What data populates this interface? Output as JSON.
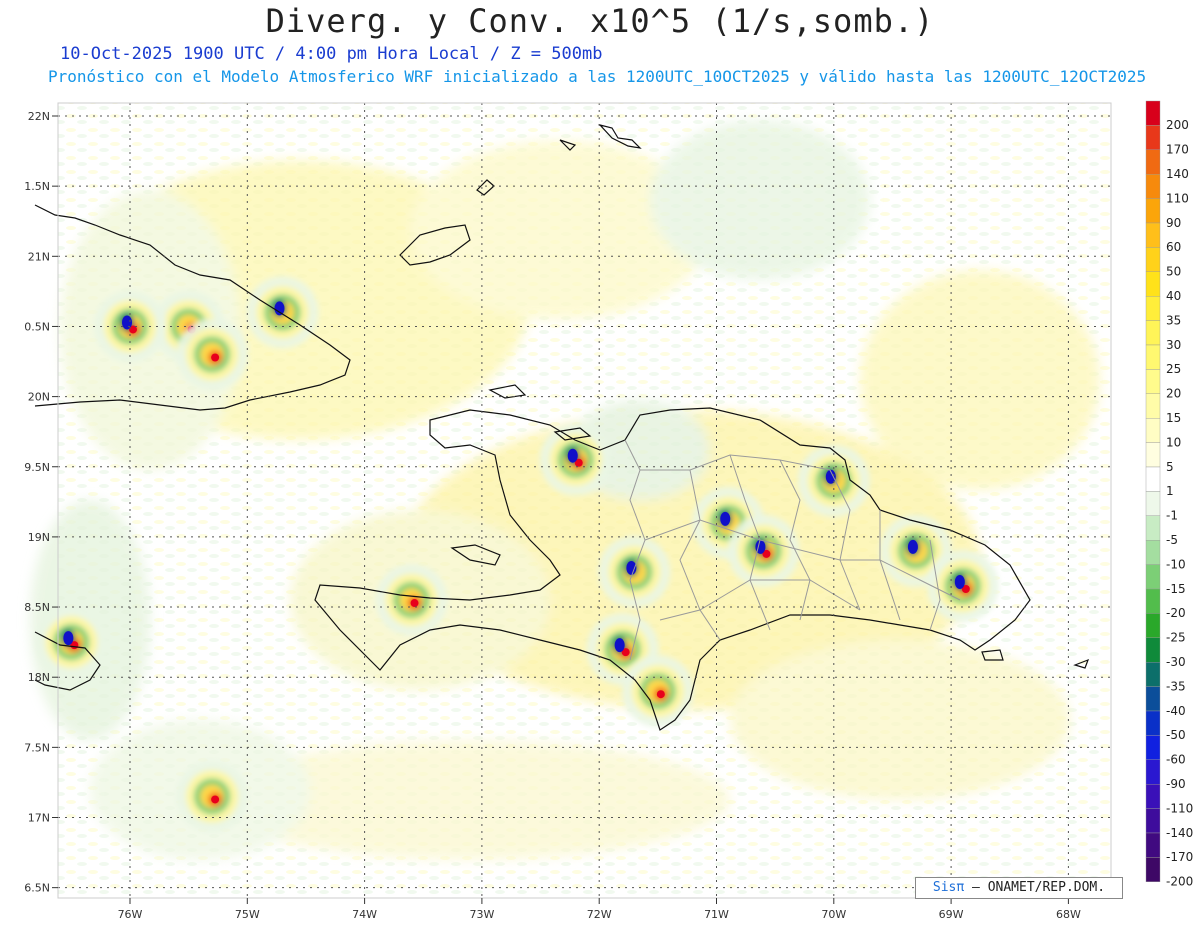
{
  "header": {
    "title": "Diverg. y Conv. x10^5 (1/s,somb.)",
    "subtitle_date": "10-Oct-2025  1900 UTC / 4:00 pm Hora Local / Z = 500mb",
    "subtitle_model": "Pronóstico con el Modelo Atmosferico WRF inicializado a las 1200UTC_10OCT2025 y válido hasta las  1200UTC_12OCT2025"
  },
  "map": {
    "lat_labels": [
      "22N",
      "1.5N",
      "21N",
      "0.5N",
      "20N",
      "9.5N",
      "19N",
      "8.5N",
      "18N",
      "7.5N",
      "17N",
      "6.5N"
    ],
    "lon_labels": [
      "76W",
      "75W",
      "74W",
      "73W",
      "72W",
      "71W",
      "70W",
      "69W",
      "68W"
    ],
    "features": [
      {
        "name": "convective-cell",
        "lon": -75.5,
        "lat": 20.5,
        "kind": "div"
      },
      {
        "name": "convective-cell",
        "lon": -74.7,
        "lat": 20.6,
        "kind": "conv"
      },
      {
        "name": "convective-cell",
        "lon": -76.0,
        "lat": 20.5,
        "kind": "mix"
      },
      {
        "name": "convective-cell",
        "lon": -75.3,
        "lat": 20.3,
        "kind": "div"
      },
      {
        "name": "convective-cell",
        "lon": -72.2,
        "lat": 19.55,
        "kind": "mix"
      },
      {
        "name": "convective-cell",
        "lon": -71.7,
        "lat": 18.75,
        "kind": "conv"
      },
      {
        "name": "convective-cell",
        "lon": -71.8,
        "lat": 18.2,
        "kind": "mix"
      },
      {
        "name": "convective-cell",
        "lon": -71.5,
        "lat": 17.9,
        "kind": "div"
      },
      {
        "name": "convective-cell",
        "lon": -70.9,
        "lat": 19.1,
        "kind": "conv"
      },
      {
        "name": "convective-cell",
        "lon": -70.6,
        "lat": 18.9,
        "kind": "mix"
      },
      {
        "name": "convective-cell",
        "lon": -70.0,
        "lat": 19.4,
        "kind": "conv"
      },
      {
        "name": "convective-cell",
        "lon": -69.3,
        "lat": 18.9,
        "kind": "conv"
      },
      {
        "name": "convective-cell",
        "lon": -68.9,
        "lat": 18.65,
        "kind": "mix"
      },
      {
        "name": "convective-cell",
        "lon": -73.6,
        "lat": 18.55,
        "kind": "div"
      },
      {
        "name": "convective-cell",
        "lon": -76.5,
        "lat": 18.25,
        "kind": "mix"
      },
      {
        "name": "convective-cell",
        "lon": -75.3,
        "lat": 17.15,
        "kind": "div"
      }
    ],
    "colors": {
      "div_max": "#e8001c",
      "conv_max": "#1010c8",
      "coast": "#111111",
      "province": "#9a9a9a",
      "grid": "#555555"
    }
  },
  "colorbar": {
    "labels": [
      "200",
      "170",
      "140",
      "110",
      "90",
      "60",
      "50",
      "40",
      "35",
      "30",
      "25",
      "20",
      "15",
      "10",
      "5",
      "1",
      "-1",
      "-5",
      "-10",
      "-15",
      "-20",
      "-25",
      "-30",
      "-35",
      "-40",
      "-50",
      "-60",
      "-90",
      "-110",
      "-140",
      "-170",
      "-200"
    ],
    "colors": [
      "#d8001b",
      "#e8381a",
      "#f06a12",
      "#f78a0c",
      "#fba50a",
      "#ffbf1a",
      "#ffd21a",
      "#ffe21a",
      "#ffee3a",
      "#fff458",
      "#fff870",
      "#fffb8c",
      "#fffca8",
      "#fffdc4",
      "#fffee0",
      "#ffffff",
      "#eef8ea",
      "#c8ecc4",
      "#a4dea0",
      "#7ccf76",
      "#52bd4c",
      "#2aa82a",
      "#0f8a3a",
      "#0c6f6a",
      "#0b4e9a",
      "#0a30c8",
      "#1020e0",
      "#2a18d0",
      "#3a10b8",
      "#3e0c9c",
      "#400a80",
      "#3e0866"
    ]
  },
  "credit": {
    "brand": "Sisπ",
    "text": "ONAMET/REP.DOM."
  }
}
